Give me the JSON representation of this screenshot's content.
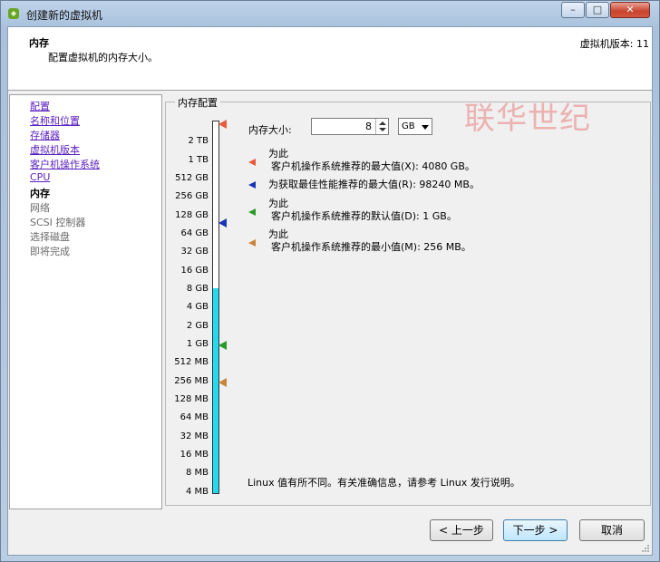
{
  "window": {
    "title": "创建新的虚拟机",
    "controls": {
      "minimize": "–",
      "maximize": "□",
      "close": "✕"
    }
  },
  "header": {
    "title": "内存",
    "subtitle": "配置虚拟机的内存大小。",
    "version": "虚拟机版本: 11"
  },
  "nav": {
    "items": [
      {
        "label": "配置",
        "state": "link"
      },
      {
        "label": "名称和位置",
        "state": "link"
      },
      {
        "label": "存储器",
        "state": "link"
      },
      {
        "label": "虚拟机版本",
        "state": "link"
      },
      {
        "label": "客户机操作系统",
        "state": "link"
      },
      {
        "label": "CPU",
        "state": "link"
      },
      {
        "label": "内存",
        "state": "current"
      },
      {
        "label": "网络",
        "state": "future"
      },
      {
        "label": "SCSI 控制器",
        "state": "future"
      },
      {
        "label": "选择磁盘",
        "state": "future"
      },
      {
        "label": "即将完成",
        "state": "future"
      }
    ]
  },
  "memory_config": {
    "group_title": "内存配置",
    "memory_size_label": "内存大小:",
    "memory_value": "8",
    "unit": "GB",
    "scale_labels": [
      "2 TB",
      "1 TB",
      "512 GB",
      "256 GB",
      "128 GB",
      "64 GB",
      "32 GB",
      "16 GB",
      "8 GB",
      "4 GB",
      "2 GB",
      "1 GB",
      "512 MB",
      "256 MB",
      "128 MB",
      "64 MB",
      "32 MB",
      "16 MB",
      "8 MB",
      "4 MB"
    ],
    "legend": [
      {
        "line1": "为此",
        "line2": "客户机操作系统推荐的最大值(X): 4080 GB。",
        "color": "#e85a3a"
      },
      {
        "line1": "",
        "line2": "为获取最佳性能推荐的最大值(R): 98240 MB。",
        "color": "#1a34b8"
      },
      {
        "line1": "为此",
        "line2": "客户机操作系统推荐的默认值(D): 1 GB。",
        "color": "#2a9a2a"
      },
      {
        "line1": "为此",
        "line2": "客户机操作系统推荐的最小值(M): 256 MB。",
        "color": "#c8843a"
      }
    ],
    "note": "Linux 值有所不同。有关准确信息，请参考 Linux 发行说明。"
  },
  "watermark": "联华世纪",
  "buttons": {
    "back": "< 上一步",
    "next": "下一步 >",
    "cancel": "取消"
  }
}
